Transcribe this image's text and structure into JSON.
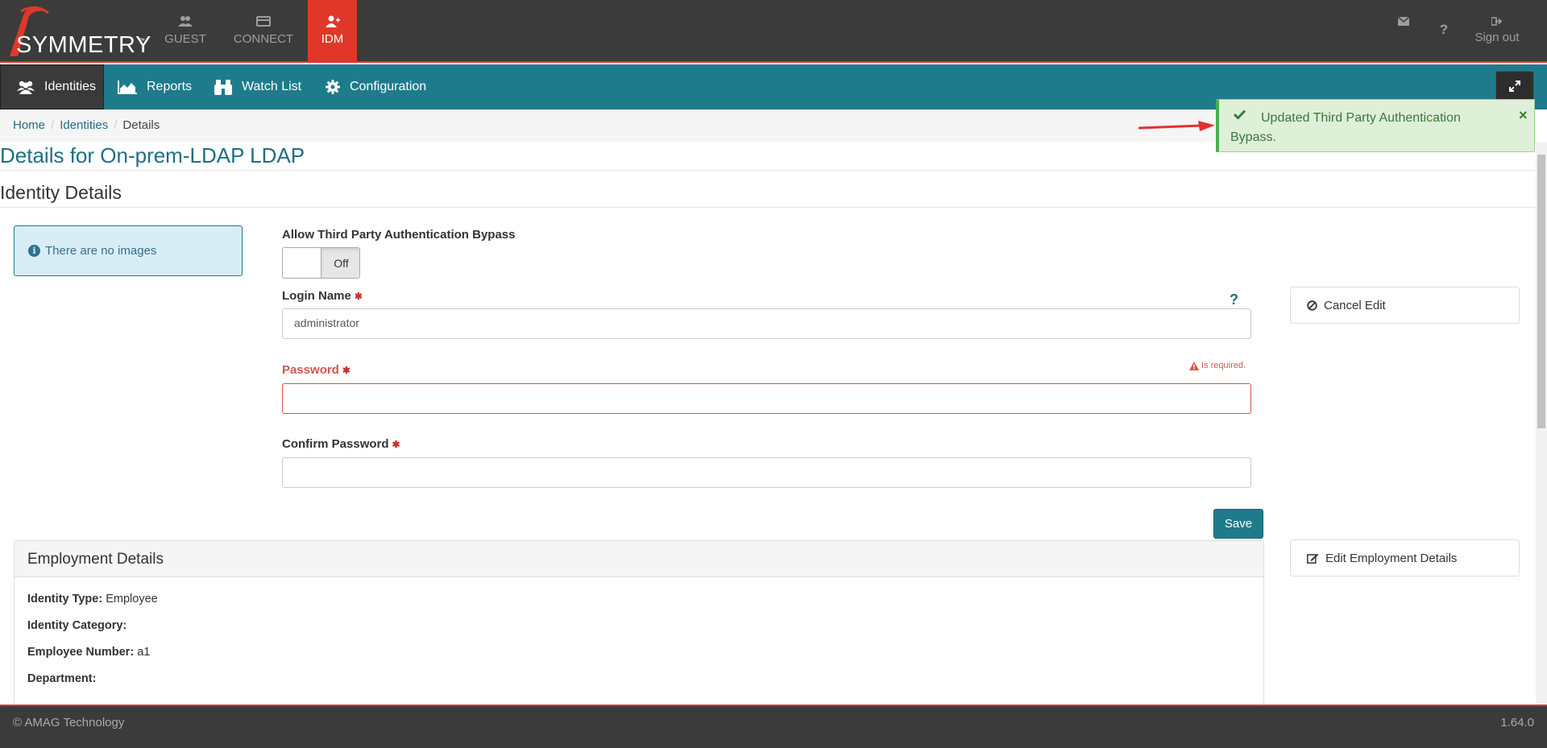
{
  "brand": {
    "name": "SYMMETRY",
    "tm": "™",
    "accent": "#e0372a",
    "nav_color": "#1e7b8c"
  },
  "modules": [
    {
      "label": "GUEST",
      "icon": "users-icon"
    },
    {
      "label": "CONNECT",
      "icon": "card-icon"
    },
    {
      "label": "IDM",
      "icon": "user-plus-icon",
      "active": true
    }
  ],
  "top_actions": {
    "sign_out": "Sign out",
    "help": "?"
  },
  "nav": [
    {
      "label": "Identities",
      "icon": "users-icon",
      "active": true
    },
    {
      "label": "Reports",
      "icon": "area-chart-icon"
    },
    {
      "label": "Watch List",
      "icon": "binoculars-icon"
    },
    {
      "label": "Configuration",
      "icon": "gear-icon"
    }
  ],
  "breadcrumb": [
    "Home",
    "Identities",
    "Details"
  ],
  "page_title": "Details for On-prem-LDAP LDAP",
  "section_title": "Identity Details",
  "images_notice": "There are no images",
  "form": {
    "bypass_label": "Allow Third Party Authentication Bypass",
    "bypass_state": "Off",
    "login_label": "Login Name",
    "login_value": "administrator",
    "password_label": "Password",
    "password_error": "Is required.",
    "confirm_label": "Confirm Password",
    "help": "?",
    "save": "Save"
  },
  "side_buttons": {
    "cancel_edit": "Cancel Edit",
    "edit_employment": "Edit Employment Details"
  },
  "employment": {
    "title": "Employment Details",
    "fields": [
      {
        "label": "Identity Type:",
        "value": "Employee"
      },
      {
        "label": "Identity Category:",
        "value": ""
      },
      {
        "label": "Employee Number:",
        "value": "a1"
      },
      {
        "label": "Department:",
        "value": ""
      }
    ]
  },
  "toast": {
    "message": "Updated Third Party Authentication Bypass.",
    "close": "×"
  },
  "footer": {
    "copyright": "© AMAG Technology",
    "version": "1.64.0"
  }
}
